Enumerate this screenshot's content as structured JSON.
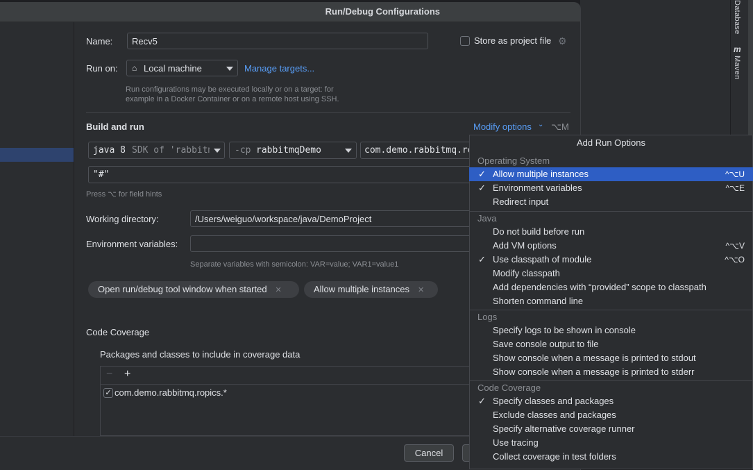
{
  "dialog": {
    "title": "Run/Debug Configurations",
    "name_label": "Name:",
    "name_value": "Recv5",
    "store_label": "Store as project file",
    "run_on_label": "Run on:",
    "run_on_value": "Local machine",
    "manage_targets": "Manage targets...",
    "run_on_hint_1": "Run configurations may be executed locally or on a target: for",
    "run_on_hint_2": "example in a Docker Container or on a remote host using SSH.",
    "build_run_label": "Build and run",
    "modify_options": "Modify options",
    "modify_shortcut": "⌥M",
    "jdk_version": "java 8",
    "jdk_desc": "SDK of 'rabbitm",
    "cp_prefix": "-cp",
    "cp_module": "rabbitmqDemo",
    "main_class": "com.demo.rabbitmq.ro",
    "program_args": "\"#\"",
    "field_hint": "Press ⌥ for field hints",
    "working_dir_label": "Working directory:",
    "working_dir_value": "/Users/weiguo/workspace/java/DemoProject",
    "env_label": "Environment variables:",
    "env_value": "",
    "env_hint": "Separate variables with semicolon: VAR=value; VAR1=value1",
    "chips": [
      "Open run/debug tool window when started",
      "Allow multiple instances"
    ],
    "coverage_label": "Code Coverage",
    "packages_label": "Packages and classes to include in coverage data",
    "coverage_entry": "com.demo.rabbitmq.ropics.*",
    "cancel": "Cancel"
  },
  "side_tabs": [
    "Database",
    "Maven"
  ],
  "popup": {
    "title": "Add Run Options",
    "groups": [
      {
        "name": "Operating System",
        "items": [
          {
            "label": "Allow multiple instances",
            "checked": true,
            "shortcut": "^⌥U",
            "selected": true
          },
          {
            "label": "Environment variables",
            "checked": true,
            "shortcut": "^⌥E"
          },
          {
            "label": "Redirect input",
            "checked": false,
            "shortcut": ""
          }
        ]
      },
      {
        "name": "Java",
        "items": [
          {
            "label": "Do not build before run",
            "checked": false,
            "shortcut": ""
          },
          {
            "label": "Add VM options",
            "checked": false,
            "shortcut": "^⌥V"
          },
          {
            "label": "Use classpath of module",
            "checked": true,
            "shortcut": "^⌥O"
          },
          {
            "label": "Modify classpath",
            "checked": false,
            "shortcut": ""
          },
          {
            "label": "Add dependencies with “provided” scope to classpath",
            "checked": false,
            "shortcut": ""
          },
          {
            "label": "Shorten command line",
            "checked": false,
            "shortcut": ""
          }
        ]
      },
      {
        "name": "Logs",
        "items": [
          {
            "label": "Specify logs to be shown in console",
            "checked": false,
            "shortcut": ""
          },
          {
            "label": "Save console output to file",
            "checked": false,
            "shortcut": ""
          },
          {
            "label": "Show console when a message is printed to stdout",
            "checked": false,
            "shortcut": ""
          },
          {
            "label": "Show console when a message is printed to stderr",
            "checked": false,
            "shortcut": ""
          }
        ]
      },
      {
        "name": "Code Coverage",
        "items": [
          {
            "label": "Specify classes and packages",
            "checked": true,
            "shortcut": ""
          },
          {
            "label": "Exclude classes and packages",
            "checked": false,
            "shortcut": ""
          },
          {
            "label": "Specify alternative coverage runner",
            "checked": false,
            "shortcut": ""
          },
          {
            "label": "Use tracing",
            "checked": false,
            "shortcut": ""
          },
          {
            "label": "Collect coverage in test folders",
            "checked": false,
            "shortcut": ""
          }
        ]
      }
    ]
  },
  "colors": {
    "accent": "#2e5ec4",
    "link": "#589df6",
    "background": "#2b2d30"
  }
}
